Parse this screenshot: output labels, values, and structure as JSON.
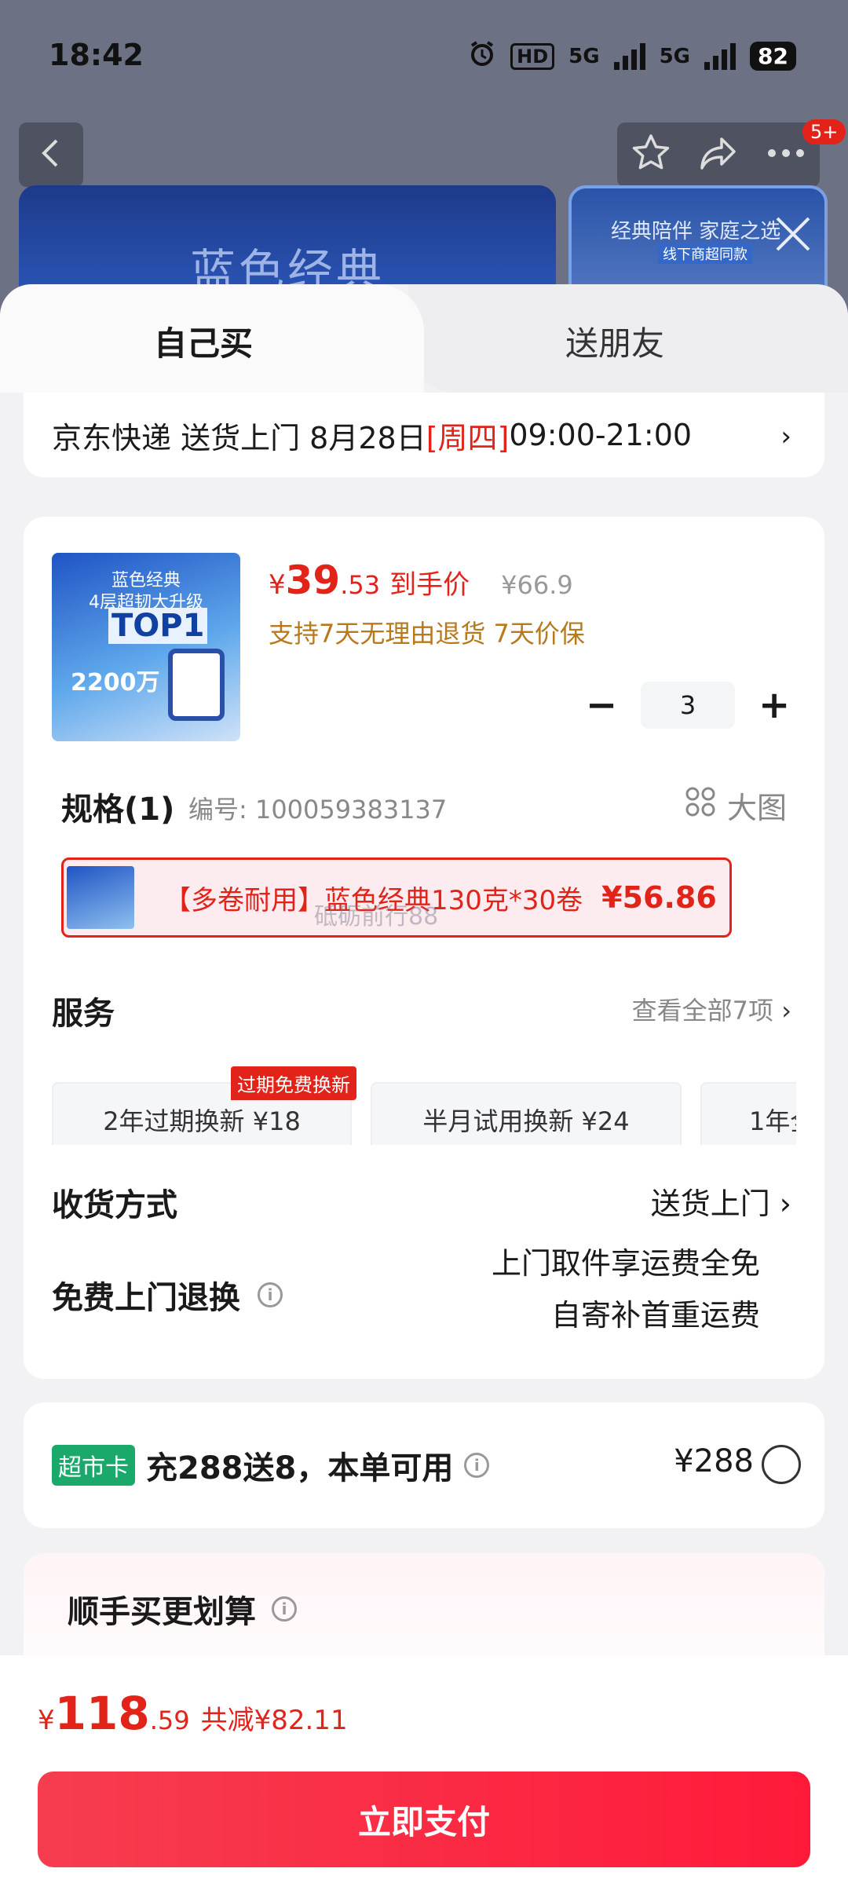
{
  "status": {
    "time": "18:42",
    "hd": "HD",
    "net1": "5G",
    "net2": "5G",
    "battery": "82"
  },
  "nav": {
    "badge": "5+"
  },
  "banner": {
    "title": "蓝色经典",
    "slogan": "经典陪伴 家庭之选",
    "sub": "线下商超同款"
  },
  "tabs": {
    "self": "自己买",
    "friend": "送朋友"
  },
  "delivery": {
    "carrier": "京东快递 送货上门 8月28日 ",
    "weekday": "[周四]",
    "window": " 09:00-21:00",
    "chev": "›"
  },
  "product": {
    "image_text1": "蓝色经典",
    "image_text2": "4层超韧大升级",
    "image_top": "TOP1",
    "image_count": "2200万",
    "price_symbol": "¥",
    "price_int": "39",
    "price_dec": ".53",
    "price_label": "到手价",
    "original_price": "¥66.9",
    "guarantee": "支持7天无理由退货  7天价保",
    "qty": "3",
    "minus": "−",
    "plus": "+"
  },
  "spec": {
    "title": "规格(1)",
    "code": "编号: 100059383137",
    "big_image": "大图"
  },
  "sku": {
    "text": "【多卷耐用】蓝色经典130克*30卷",
    "price": "¥56.86",
    "watermark": "砥砺前行88"
  },
  "service": {
    "title": "服务",
    "view_all": "查看全部7项",
    "chev": "›",
    "items": [
      {
        "label": "2年过期换新  ¥18",
        "tag": "过期免费换新"
      },
      {
        "label": "半月试用换新  ¥24"
      },
      {
        "label": "1年全"
      }
    ]
  },
  "receive": {
    "title": "收货方式",
    "value": "送货上门",
    "chev": "›"
  },
  "returns": {
    "title": "免费上门退换",
    "line1": "上门取件享运费全免",
    "line2": "自寄补首重运费"
  },
  "market": {
    "tag": "超市卡",
    "text": "充288送8，本单可用",
    "amount": "¥288"
  },
  "deal": {
    "title": "顺手买更划算"
  },
  "total": {
    "symbol": "¥",
    "int": "118",
    "dec": ".59",
    "save": "共减¥82.11"
  },
  "pay": {
    "label": "立即支付"
  },
  "colors": {
    "accent": "#e2231a",
    "market_tag": "#1aa96a",
    "guarantee": "#b8791d"
  }
}
